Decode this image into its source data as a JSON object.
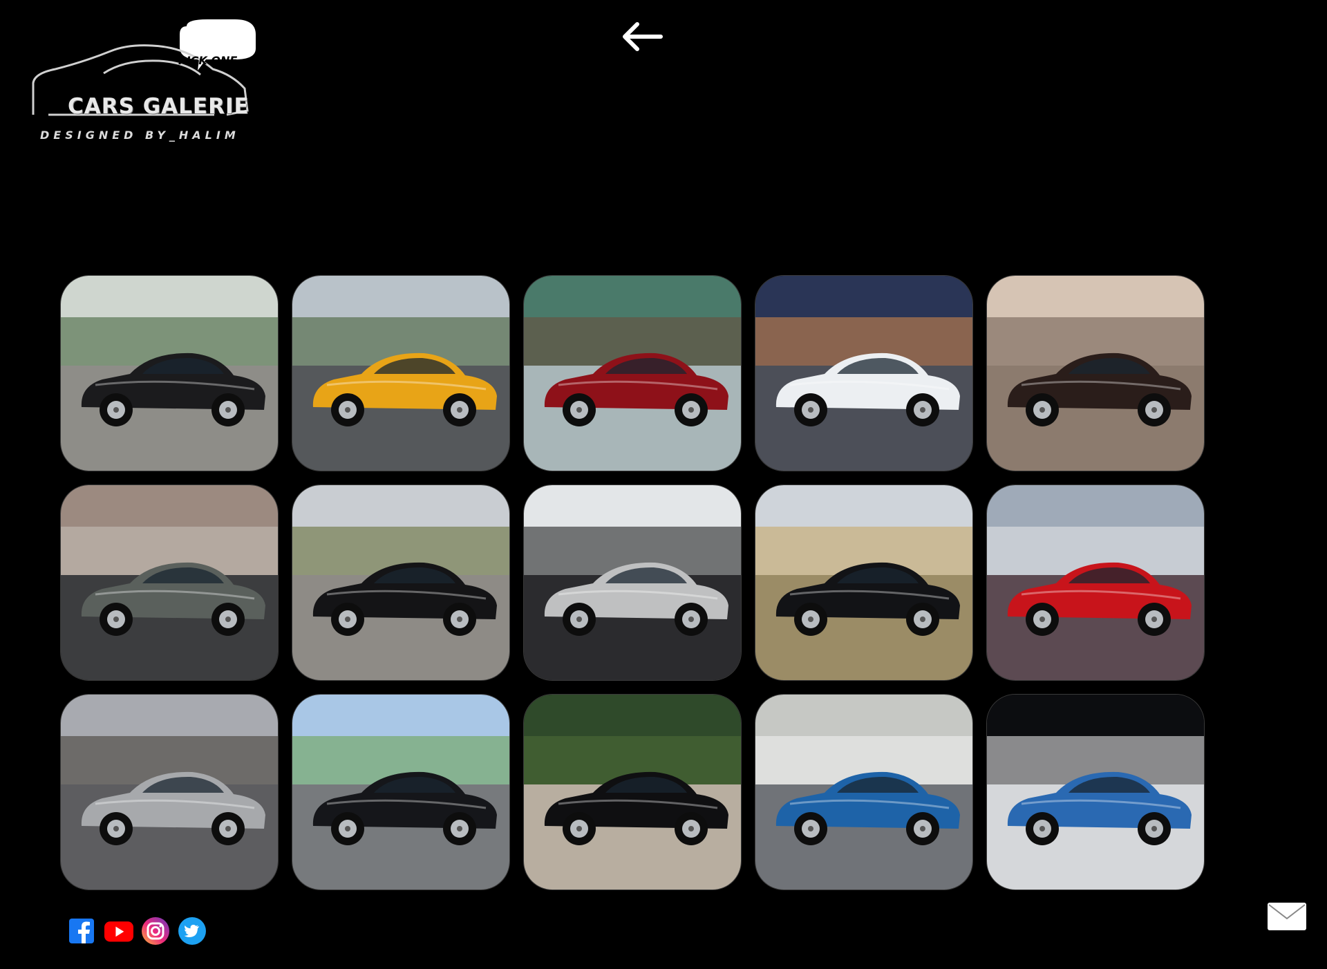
{
  "logo": {
    "bubble": "PICK ONE",
    "title": "CARS GALERIE",
    "subtitle": "DESIGNED BY_HALIM"
  },
  "header": {
    "back_icon": "arrow-left-icon"
  },
  "gallery": {
    "cards": [
      {
        "name": "black-modern-camaro",
        "sky": "#cfd6cf",
        "ground": "#8e8d88",
        "car": "#1b1b1d",
        "accent": "#3b5d33"
      },
      {
        "name": "yellow-camaro-bumblebee",
        "sky": "#b9c2c9",
        "ground": "#55585b",
        "car": "#e8a417",
        "accent": "#3e5a2d"
      },
      {
        "name": "red-classic-nova",
        "sky": "#4a7a6a",
        "ground": "#a8b6b8",
        "car": "#8e1119",
        "accent": "#6b4a38"
      },
      {
        "name": "white-camaro-neon",
        "sky": "#2a3556",
        "ground": "#4c4f58",
        "car": "#eceff2",
        "accent": "#d88a4a"
      },
      {
        "name": "sepia-impala-67",
        "sky": "#d6c4b4",
        "ground": "#8c7b6e",
        "car": "#2a1d1a",
        "accent": "#6b5a4e"
      },
      {
        "name": "green-chevy-pickup",
        "sky": "#9c8a80",
        "ground": "#3c3d3f",
        "car": "#5a605c",
        "accent": "#c9c2ba"
      },
      {
        "name": "black-bel-air-57",
        "sky": "#c9cdd2",
        "ground": "#8e8b86",
        "car": "#141416",
        "accent": "#5e6a2e"
      },
      {
        "name": "bel-air-interior",
        "sky": "#e3e6e8",
        "ground": "#2b2b2e",
        "car": "#bfc0c1",
        "accent": "#141414"
      },
      {
        "name": "black-corvette-c1",
        "sky": "#cfd4da",
        "ground": "#9b8c66",
        "car": "#121316",
        "accent": "#c7a460"
      },
      {
        "name": "red-corvette-stingray",
        "sky": "#9faab8",
        "ground": "#5c4a52",
        "car": "#c8141b",
        "accent": "#e8e8ea"
      },
      {
        "name": "silver-camaro-68",
        "sky": "#a8aab0",
        "ground": "#5d5d60",
        "car": "#a7a9ac",
        "accent": "#3c3630"
      },
      {
        "name": "black-impala-garage",
        "sky": "#a9c7e6",
        "ground": "#777a7d",
        "car": "#15161a",
        "accent": "#6aa04a"
      },
      {
        "name": "black-corvette-c3",
        "sky": "#2f4a2a",
        "ground": "#b8aea0",
        "car": "#0f0f11",
        "accent": "#4e6d36"
      },
      {
        "name": "blue-camaro-z28",
        "sky": "#c6c8c4",
        "ground": "#707378",
        "car": "#1e63a8",
        "accent": "#f2f2f2"
      },
      {
        "name": "blue-camaro-ss-convertible",
        "sky": "#0c0d10",
        "ground": "#d5d7da",
        "car": "#2a69b2",
        "accent": "#f2f2f2"
      }
    ]
  },
  "social": [
    {
      "name": "facebook-icon",
      "color": "#1877f2"
    },
    {
      "name": "youtube-icon",
      "color": "#ff0000"
    },
    {
      "name": "instagram-icon",
      "color": "#d6249f"
    },
    {
      "name": "twitter-icon",
      "color": "#1da1f2"
    }
  ],
  "footer": {
    "mail_icon": "mail-icon"
  }
}
